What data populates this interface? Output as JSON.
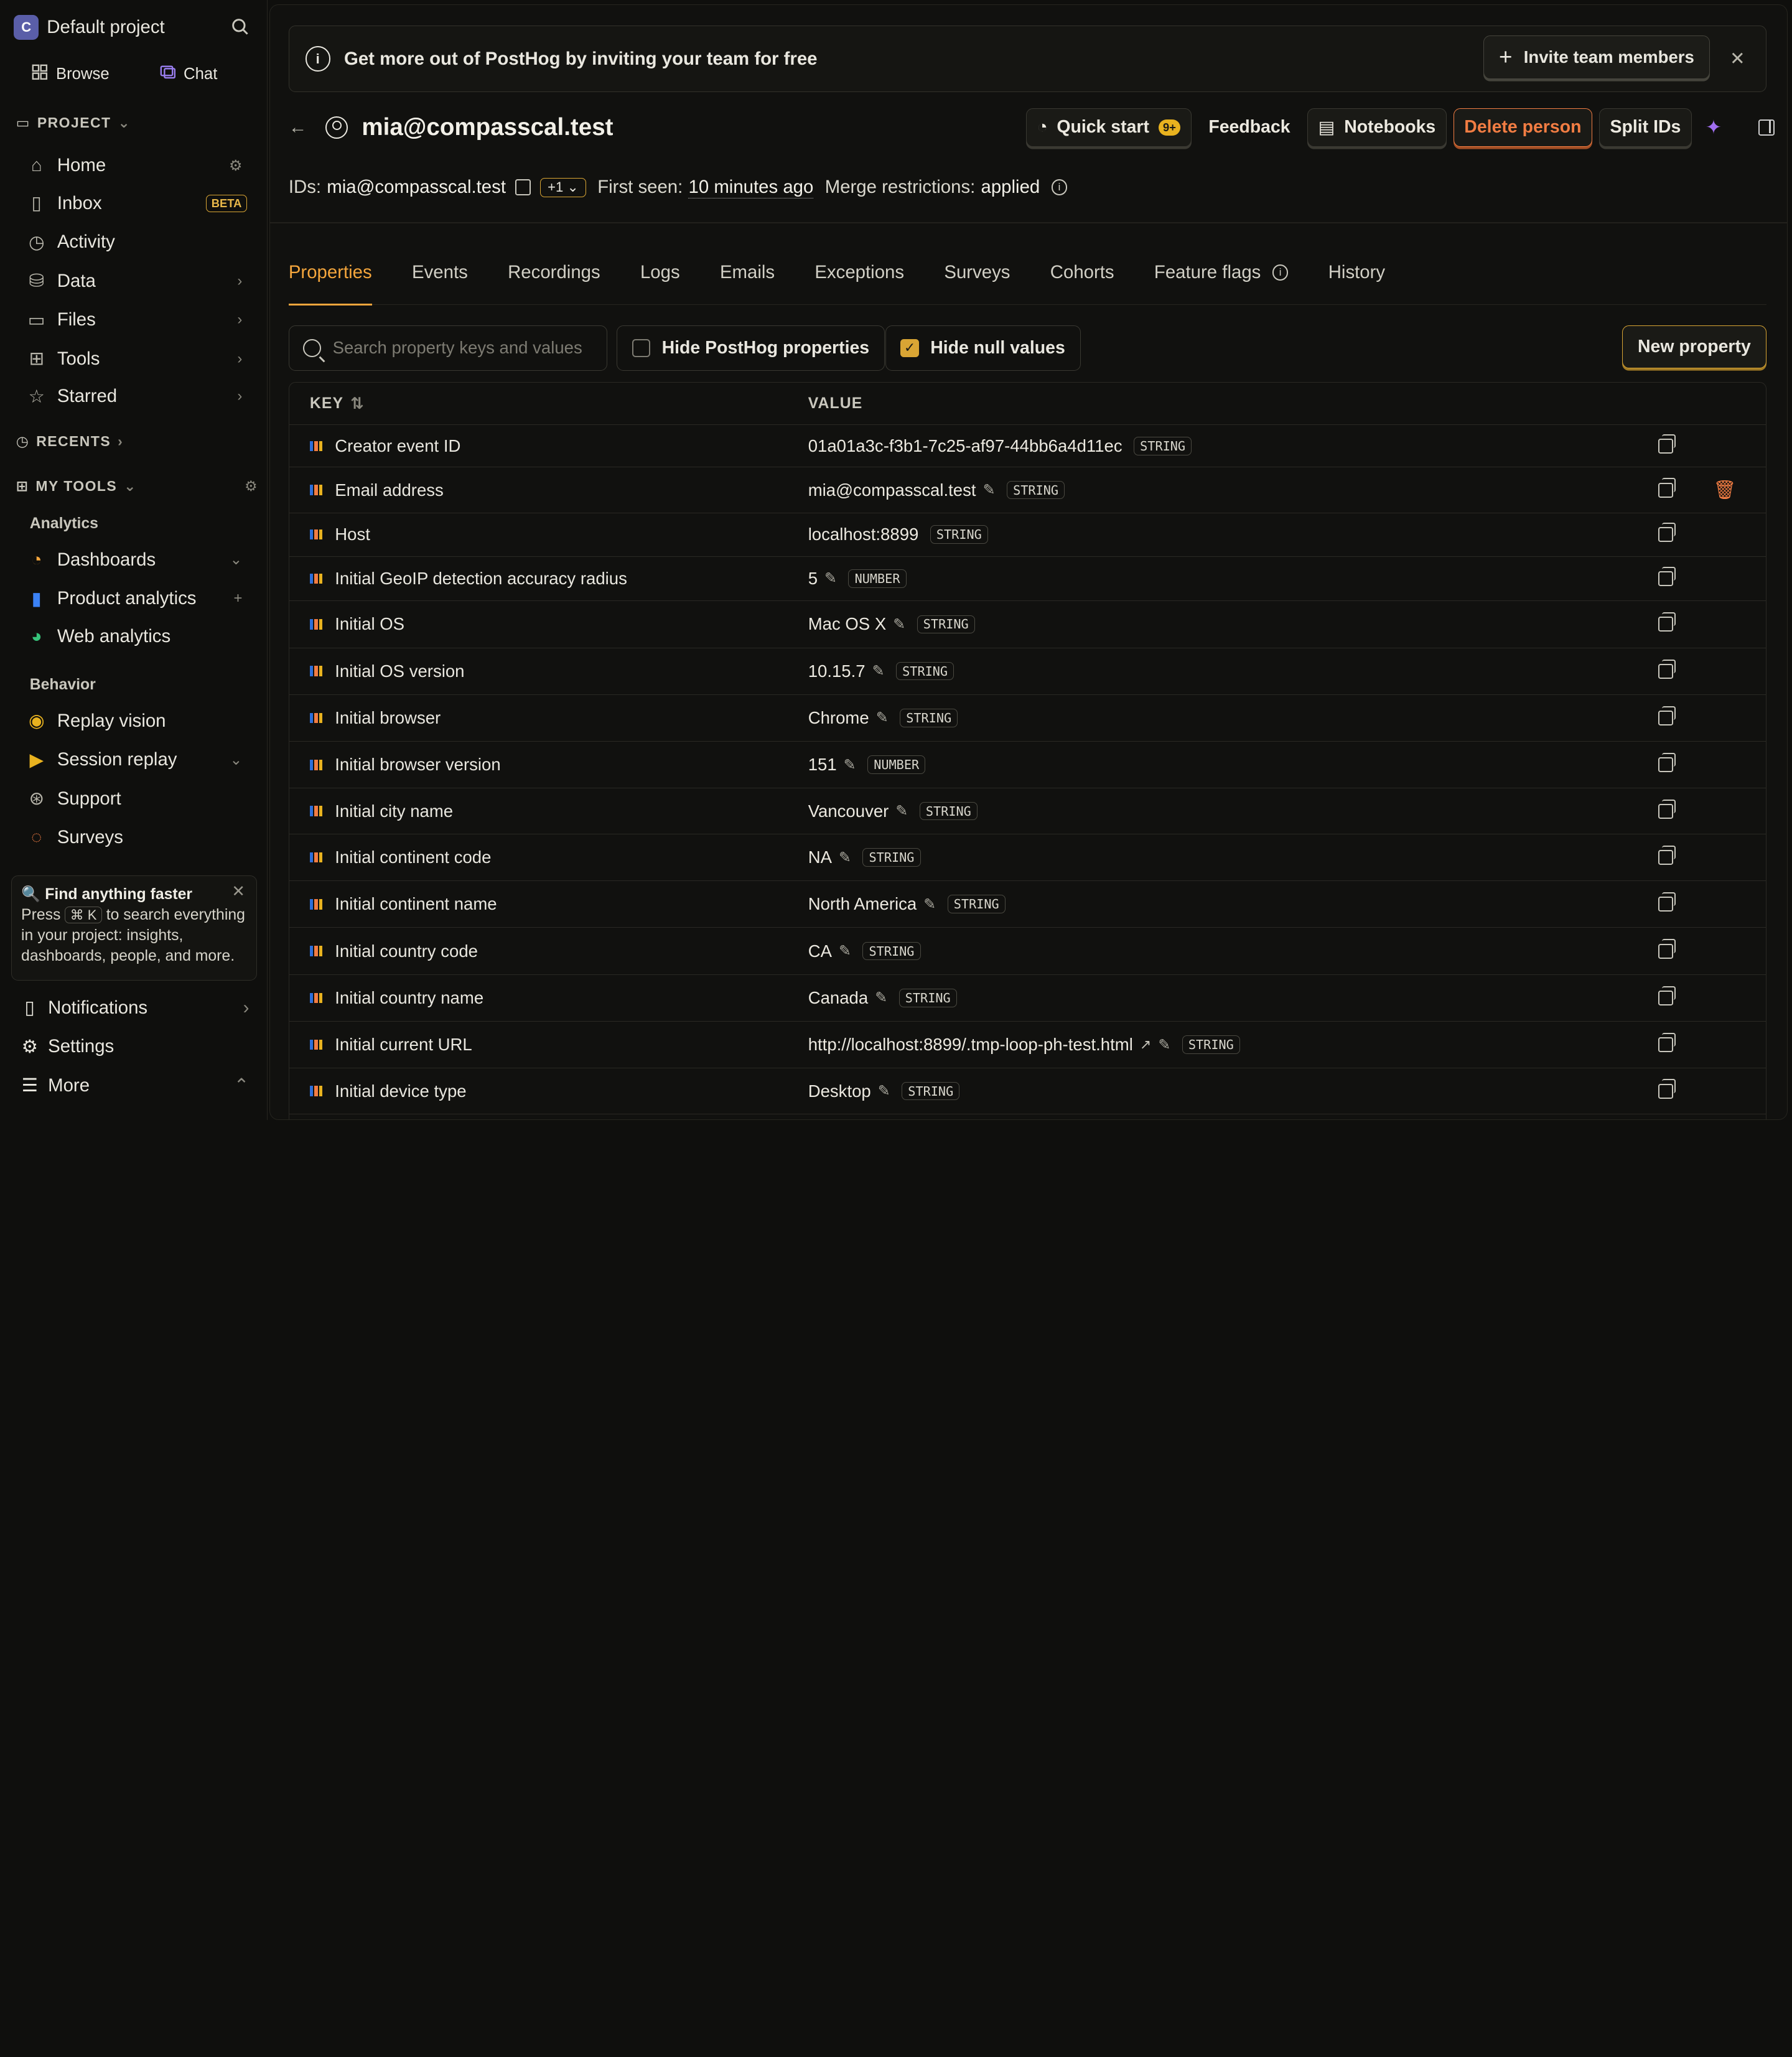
{
  "sidebar": {
    "project_initial": "C",
    "project_name": "Default project",
    "topnav": {
      "browse": "Browse",
      "chat": "Chat"
    },
    "project_section": "PROJECT",
    "items": [
      {
        "label": "Home"
      },
      {
        "label": "Inbox",
        "badge": "BETA"
      },
      {
        "label": "Activity"
      },
      {
        "label": "Data"
      },
      {
        "label": "Files"
      },
      {
        "label": "Tools"
      },
      {
        "label": "Starred"
      }
    ],
    "recents": "RECENTS",
    "my_tools": "MY TOOLS",
    "analytics_label": "Analytics",
    "analytics_items": [
      {
        "label": "Dashboards"
      },
      {
        "label": "Product analytics"
      },
      {
        "label": "Web analytics"
      }
    ],
    "behavior_label": "Behavior",
    "behavior_items": [
      {
        "label": "Replay vision"
      },
      {
        "label": "Session replay"
      },
      {
        "label": "Support"
      },
      {
        "label": "Surveys"
      }
    ],
    "tip": {
      "title": "Find anything faster",
      "press": "Press",
      "shortcut": "⌘ K",
      "rest": "to search everything in your project: insights, dashboards, people, and more."
    },
    "notifications": "Notifications",
    "settings": "Settings",
    "more": "More"
  },
  "banner": {
    "text": "Get more out of PostHog by inviting your team for free",
    "invite_label": "Invite team members"
  },
  "person": {
    "title": "mia@compasscal.test",
    "actions": {
      "quick_start": "Quick start",
      "quick_start_badge": "9+",
      "feedback": "Feedback",
      "notebooks": "Notebooks",
      "delete": "Delete person",
      "split": "Split IDs"
    },
    "ids_label": "IDs:",
    "ids_value": "mia@compasscal.test",
    "ids_more": "+1",
    "first_seen_label": "First seen:",
    "first_seen_value": "10 minutes ago",
    "merge_label": "Merge restrictions:",
    "merge_value": "applied"
  },
  "tabs": [
    "Properties",
    "Events",
    "Recordings",
    "Logs",
    "Emails",
    "Exceptions",
    "Surveys",
    "Cohorts",
    "Feature flags",
    "History"
  ],
  "filters": {
    "search_placeholder": "Search property keys and values",
    "hide_posthog": "Hide PostHog properties",
    "hide_null": "Hide null values",
    "new_property": "New property"
  },
  "table": {
    "key_header": "KEY",
    "value_header": "VALUE",
    "rows": [
      {
        "key": "Creator event ID",
        "value": "01a01a3c-f3b1-7c25-af97-44bb6a4d11ec",
        "type": "STRING"
      },
      {
        "key": "Email address",
        "value": "mia@compasscal.test",
        "type": "STRING"
      },
      {
        "key": "Host",
        "value": "localhost:8899",
        "type": "STRING"
      },
      {
        "key": "Initial GeoIP detection accuracy radius",
        "value": "5",
        "type": "NUMBER"
      },
      {
        "key": "Initial OS",
        "value": "Mac OS X",
        "type": "STRING"
      },
      {
        "key": "Initial OS version",
        "value": "10.15.7",
        "type": "STRING"
      },
      {
        "key": "Initial browser",
        "value": "Chrome",
        "type": "STRING"
      },
      {
        "key": "Initial browser version",
        "value": "151",
        "type": "NUMBER"
      },
      {
        "key": "Initial city name",
        "value": "Vancouver",
        "type": "STRING"
      },
      {
        "key": "Initial continent code",
        "value": "NA",
        "type": "STRING"
      },
      {
        "key": "Initial continent name",
        "value": "North America",
        "type": "STRING"
      },
      {
        "key": "Initial country code",
        "value": "CA",
        "type": "STRING"
      },
      {
        "key": "Initial country name",
        "value": "Canada",
        "type": "STRING"
      },
      {
        "key": "Initial current URL",
        "value": "http://localhost:8899/.tmp-loop-ph-test.html",
        "type": "STRING"
      },
      {
        "key": "Initial device type",
        "value": "Desktop",
        "type": "STRING"
      }
    ]
  },
  "colors": {
    "accent": "#f3a53c",
    "danger": "#f27d43",
    "badge": "#e8b21f"
  }
}
